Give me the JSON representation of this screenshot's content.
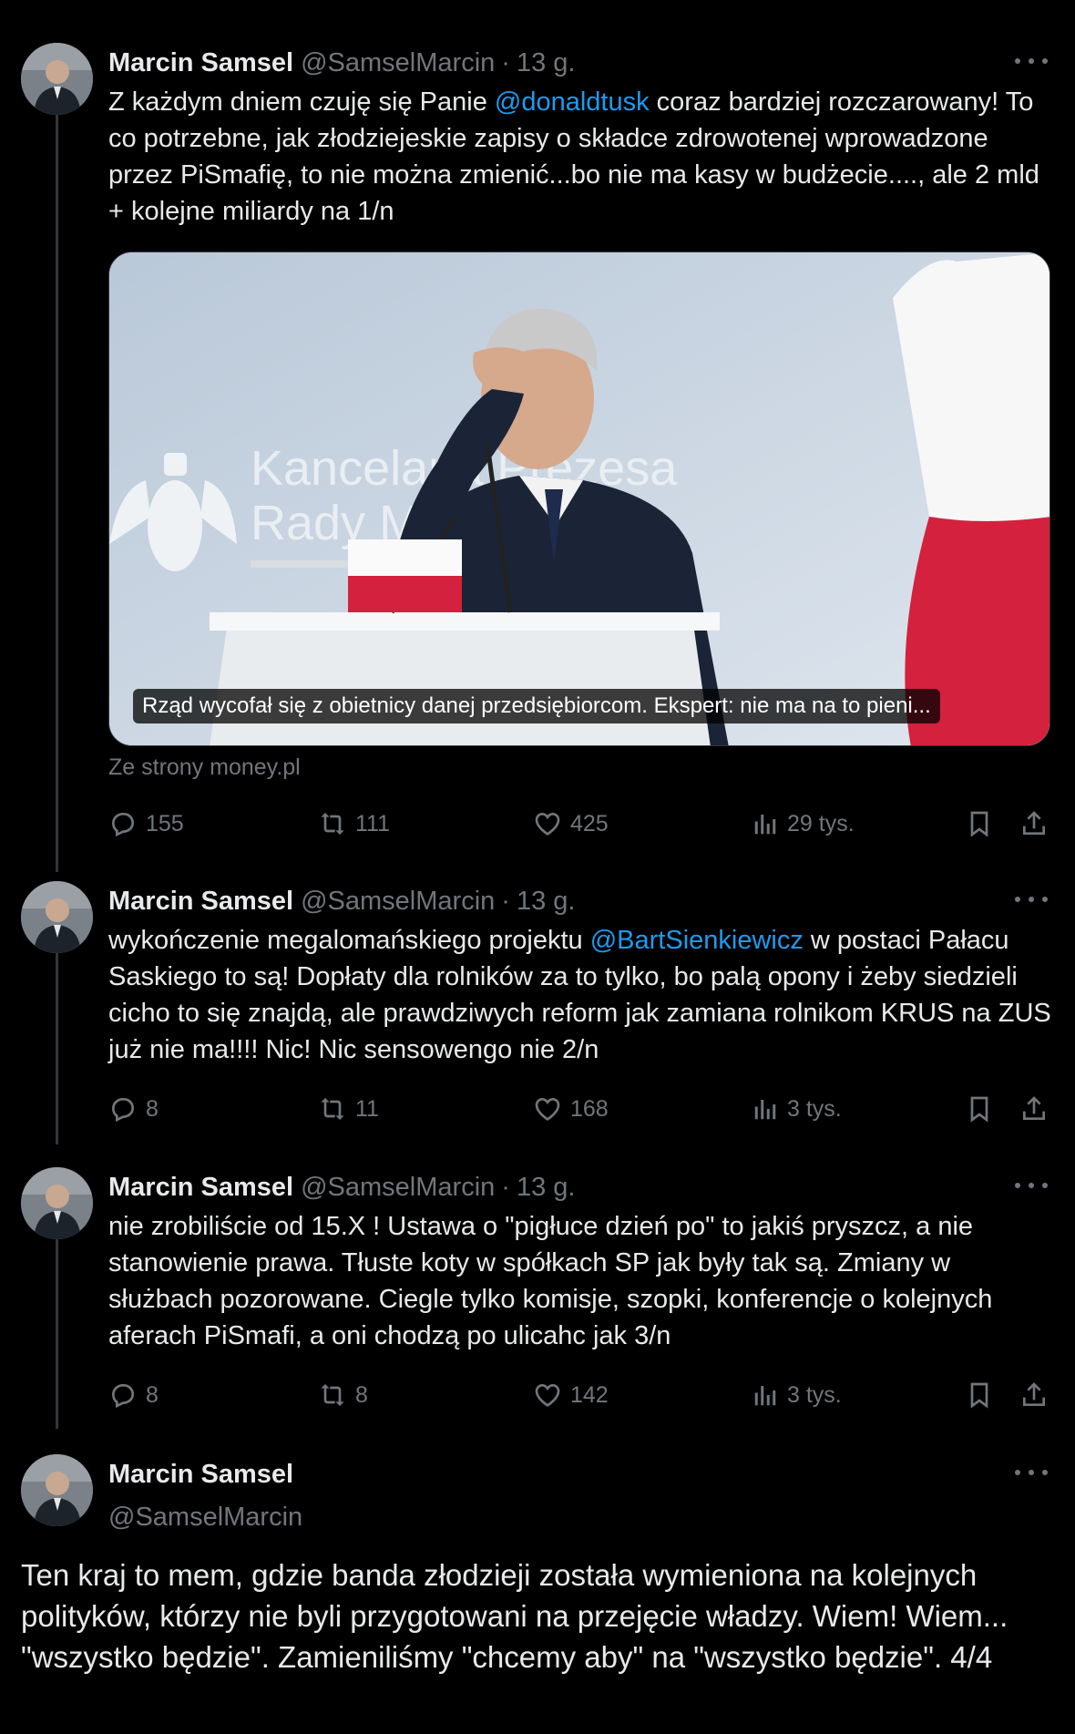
{
  "colors": {
    "background": "#000000",
    "text": "#e7e9ea",
    "muted": "#71767b",
    "link": "#1d9bf0",
    "line": "#333639"
  },
  "tweets": [
    {
      "name": "Marcin Samsel",
      "handle": "@SamselMarcin",
      "time": "13 g.",
      "text_parts": [
        "Z każdym dniem czuję się Panie ",
        "@donaldtusk",
        "  coraz bardziej rozczarowany! To co potrzebne, jak złodziejeskie zapisy o składce zdrowotenej wprowadzone przez PiSmafię, to nie można zmienić...bo nie ma kasy w budżecie...., ale 2 mld + kolejne miliardy na 1/n"
      ],
      "card": {
        "caption": "Rząd wycofał się z obietnicy danej przedsiębiorcom. Ekspert: nie ma na to pieni...",
        "source": "Ze strony money.pl",
        "background_text": [
          "Kancelaria Prezesa",
          "Rady Ministrów"
        ]
      },
      "stats": {
        "replies": "155",
        "reposts": "111",
        "likes": "425",
        "views": "29 tys."
      }
    },
    {
      "name": "Marcin Samsel",
      "handle": "@SamselMarcin",
      "time": "13 g.",
      "text_parts": [
        "wykończenie megalomańskiego projektu ",
        "@BartSienkiewicz",
        "  w postaci Pałacu Saskiego to są!    Dopłaty dla rolników za to tylko, bo palą opony i żeby siedzieli cicho to się znajdą, ale  prawdziwych reform jak zamiana rolnikom KRUS na ZUS już nie ma!!!!  Nic! Nic sensowengo nie 2/n"
      ],
      "stats": {
        "replies": "8",
        "reposts": "11",
        "likes": "168",
        "views": "3 tys."
      }
    },
    {
      "name": "Marcin Samsel",
      "handle": "@SamselMarcin",
      "time": "13 g.",
      "text": "nie zrobiliście od 15.X ! Ustawa o \"pigłuce dzień po\" to jakiś pryszcz, a nie stanowienie prawa.  Tłuste koty w spółkach SP jak były tak są. Zmiany w służbach pozorowane.  Ciegle tylko komisje, szopki, konferencje o kolejnych aferach PiSmafi, a oni chodzą po ulicahc jak 3/n",
      "stats": {
        "replies": "8",
        "reposts": "8",
        "likes": "142",
        "views": "3 tys."
      }
    },
    {
      "name": "Marcin Samsel",
      "handle": "@SamselMarcin",
      "text": "Ten kraj to mem, gdzie banda złodzieji została wymieniona na kolejnych polityków, którzy nie byli przygotowani na przejęcie władzy.  Wiem! Wiem... \"wszystko będzie\".  Zamieniliśmy \"chcemy aby\" na \"wszystko będzie\". 4/4"
    }
  ]
}
